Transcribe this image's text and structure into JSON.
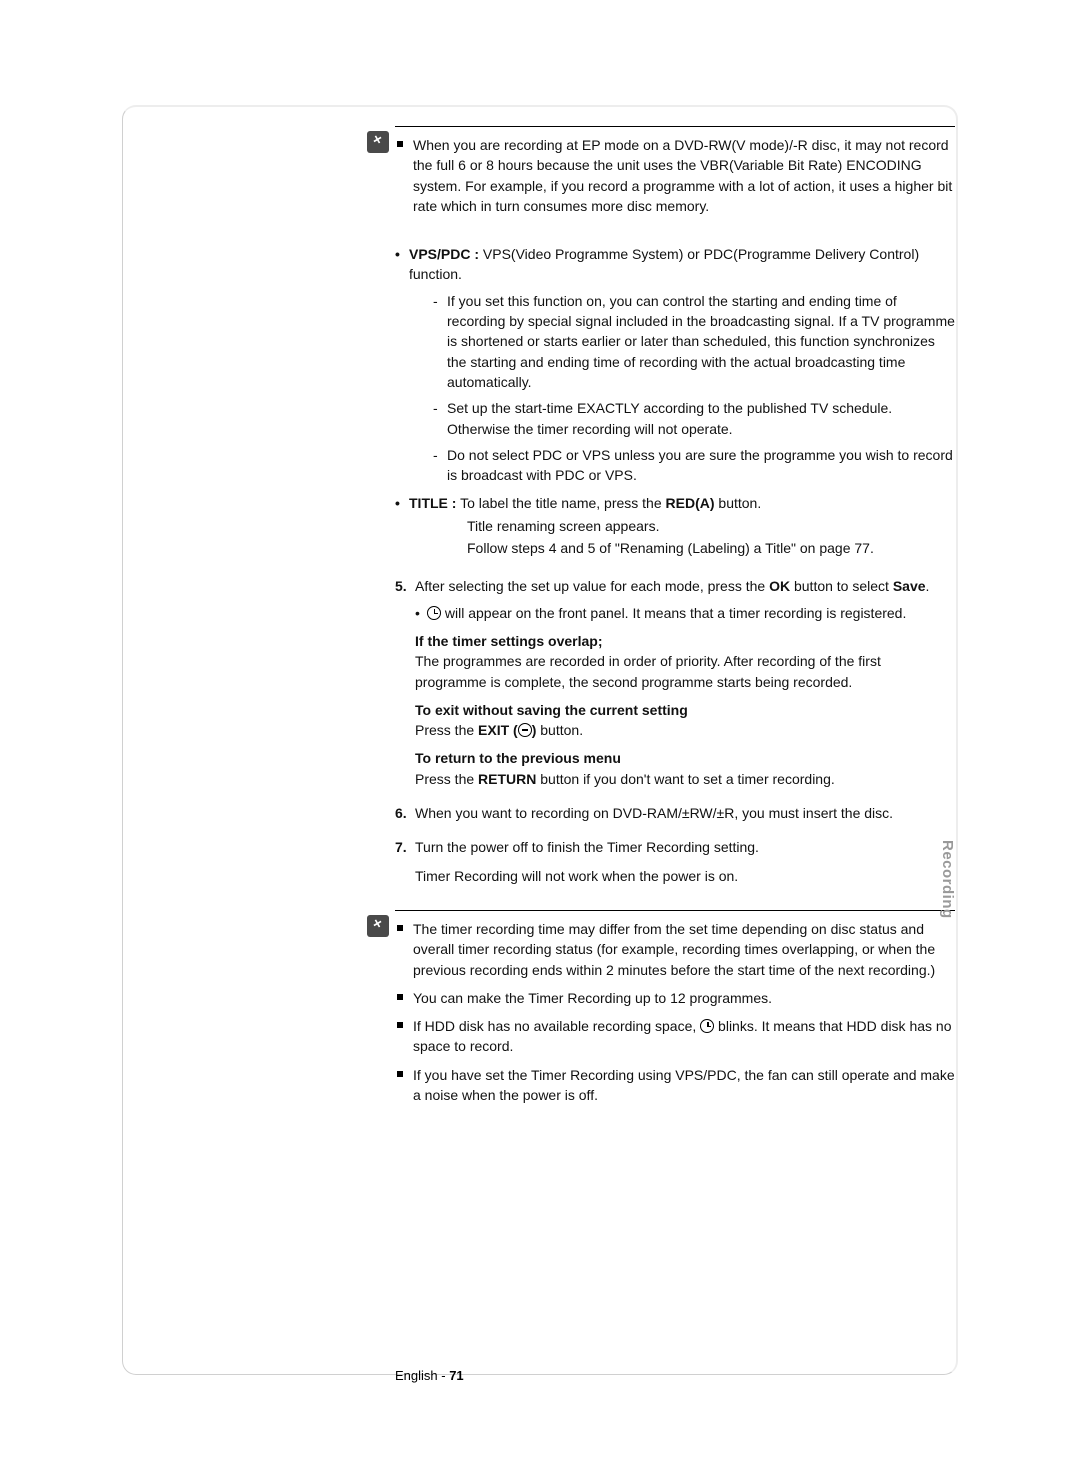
{
  "side_tab": "Recording",
  "footer_lang": "English",
  "footer_sep": " - ",
  "footer_page": "71",
  "note1": {
    "item1": "When you are recording at EP mode on a DVD-RW(V mode)/-R disc, it may not record the full 6 or 8 hours because the unit uses the VBR(Variable Bit Rate) ENCODING system. For example, if you record a programme with a lot of action, it uses a higher bit rate which in turn consumes more disc memory."
  },
  "vps": {
    "label": "VPS/PDC :",
    "desc": " VPS(Video Programme System) or PDC(Programme Delivery Control) function.",
    "d1": "If you set this function on, you can control the starting and ending time of recording by special signal included in the broadcasting signal. If a TV programme is shortened or starts earlier or later than scheduled, this function synchronizes the starting and ending time of recording with the actual broadcasting time automatically.",
    "d2": "Set up the start-time EXACTLY according to the published TV schedule. Otherwise the timer recording will not operate.",
    "d3": "Do not select PDC or VPS unless you are sure the programme you wish to record is broadcast with PDC or VPS."
  },
  "title": {
    "label": "TITLE :",
    "desc_a": " To label the title name, press the ",
    "red": "RED(A)",
    "desc_b": " button.",
    "sub1": "Title renaming screen appears.",
    "sub2": "Follow steps 4 and 5 of \"Renaming (Labeling) a Title\" on page 77."
  },
  "step5": {
    "num": "5.",
    "t1": "After selecting the set up value for each mode, press the ",
    "ok": "OK",
    "t2": " button to select ",
    "save": "Save",
    "t3": ".",
    "inner_a": " will appear on the front panel. It means that a timer recording is registered.",
    "overlap_h": "If the timer settings overlap;",
    "overlap_t": "The programmes are recorded in order of priority. After recording of the first programme is complete, the second programme starts being recorded.",
    "exit_h": "To exit without saving the current setting",
    "exit_t1": "Press the ",
    "exit_b": "EXIT (",
    "exit_b2": ")",
    "exit_t2": " button.",
    "return_h": "To return to the previous menu",
    "return_t1": "Press the ",
    "return_b": "RETURN",
    "return_t2": " button if you don't want to set a timer recording."
  },
  "step6": {
    "num": "6.",
    "t": "When you want to recording on DVD-RAM/±RW/±R, you must insert the disc."
  },
  "step7": {
    "num": "7.",
    "t1": "Turn the power off to finish the Timer Recording setting.",
    "t2": "Timer Recording will not work when the power is on."
  },
  "note2": {
    "i1": "The timer recording time may differ from the set time depending on disc status and overall timer recording status (for example, recording times overlapping, or when the previous recording ends within 2 minutes before the start time of the next recording.)",
    "i2": "You can make the Timer Recording up to 12 programmes.",
    "i3a": "If HDD disk has no available recording space, ",
    "i3b": " blinks. It means that HDD disk has no space to record.",
    "i4": "If you have set the Timer Recording using VPS/PDC, the fan can still operate and make a noise when the power is off."
  }
}
